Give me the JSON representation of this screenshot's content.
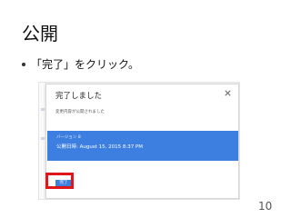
{
  "slide": {
    "title": "公開",
    "bullet": "「完了」をクリック。",
    "page_number": "10"
  },
  "dialog": {
    "title": "完了しました",
    "message": "変更内容が公開されました",
    "version_label": "バージョン 8",
    "published": "公開日時: August 15, 2015 8:37 PM",
    "done_label": "完了",
    "close_icon": "close-icon"
  },
  "colors": {
    "accent_blue": "#3d7fe0",
    "highlight_red": "#e0161a"
  }
}
